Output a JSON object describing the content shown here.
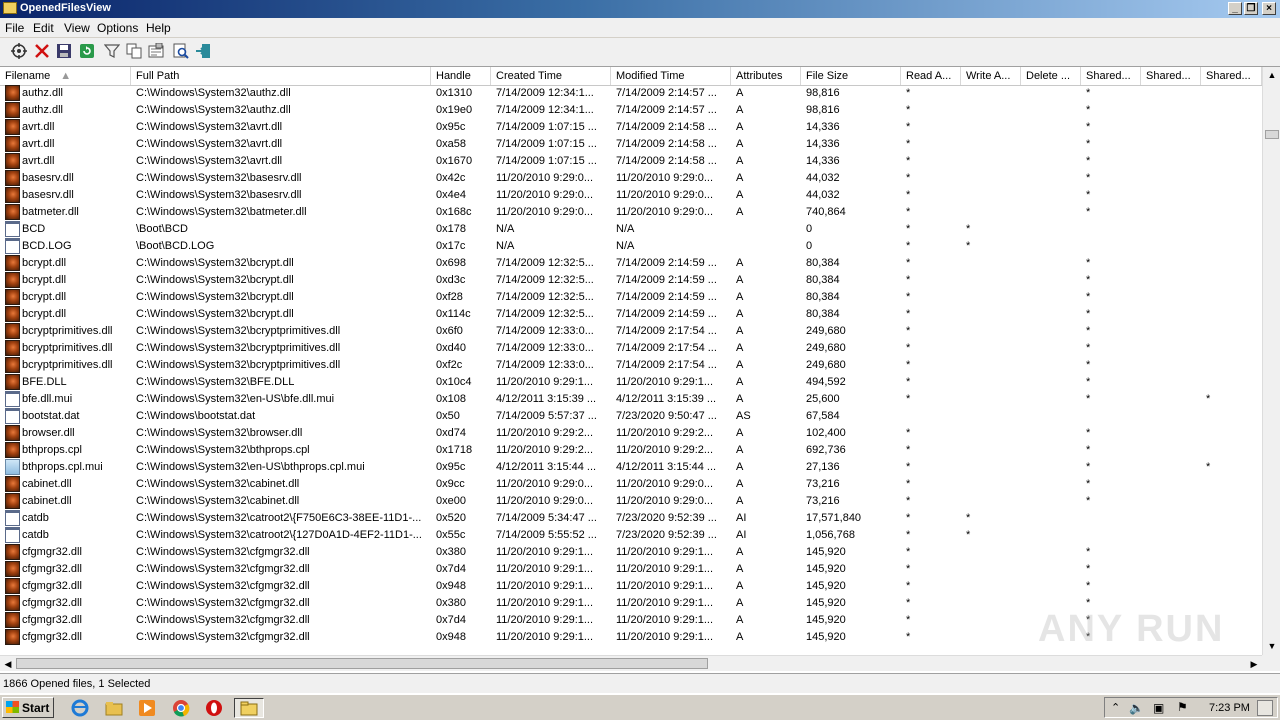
{
  "window": {
    "title": "OpenedFilesView"
  },
  "menu": [
    "File",
    "Edit",
    "View",
    "Options",
    "Help"
  ],
  "toolbar": [
    "properties-icon",
    "close-handle-icon",
    "save-icon",
    "refresh-icon",
    "filter-icon",
    "copy-icon",
    "options-icon",
    "find-icon",
    "exit-icon"
  ],
  "columns": [
    "Filename",
    "Full Path",
    "Handle",
    "Created Time",
    "Modified Time",
    "Attributes",
    "File Size",
    "Read A...",
    "Write A...",
    "Delete ...",
    "Shared...",
    "Shared...",
    "Shared..."
  ],
  "rows": [
    {
      "icon": "dll",
      "name": "authz.dll",
      "path": "C:\\Windows\\System32\\authz.dll",
      "handle": "0x1310",
      "created": "7/14/2009 12:34:1...",
      "modified": "7/14/2009 2:14:57 ...",
      "attr": "A",
      "size": "98,816",
      "read": "*",
      "write": "",
      "del": "",
      "s1": "*",
      "s2": "",
      "s3": ""
    },
    {
      "icon": "dll",
      "name": "authz.dll",
      "path": "C:\\Windows\\System32\\authz.dll",
      "handle": "0x19e0",
      "created": "7/14/2009 12:34:1...",
      "modified": "7/14/2009 2:14:57 ...",
      "attr": "A",
      "size": "98,816",
      "read": "*",
      "write": "",
      "del": "",
      "s1": "*",
      "s2": "",
      "s3": ""
    },
    {
      "icon": "dll",
      "name": "avrt.dll",
      "path": "C:\\Windows\\System32\\avrt.dll",
      "handle": "0x95c",
      "created": "7/14/2009 1:07:15 ...",
      "modified": "7/14/2009 2:14:58 ...",
      "attr": "A",
      "size": "14,336",
      "read": "*",
      "write": "",
      "del": "",
      "s1": "*",
      "s2": "",
      "s3": ""
    },
    {
      "icon": "dll",
      "name": "avrt.dll",
      "path": "C:\\Windows\\System32\\avrt.dll",
      "handle": "0xa58",
      "created": "7/14/2009 1:07:15 ...",
      "modified": "7/14/2009 2:14:58 ...",
      "attr": "A",
      "size": "14,336",
      "read": "*",
      "write": "",
      "del": "",
      "s1": "*",
      "s2": "",
      "s3": ""
    },
    {
      "icon": "dll",
      "name": "avrt.dll",
      "path": "C:\\Windows\\System32\\avrt.dll",
      "handle": "0x1670",
      "created": "7/14/2009 1:07:15 ...",
      "modified": "7/14/2009 2:14:58 ...",
      "attr": "A",
      "size": "14,336",
      "read": "*",
      "write": "",
      "del": "",
      "s1": "*",
      "s2": "",
      "s3": ""
    },
    {
      "icon": "dll",
      "name": "basesrv.dll",
      "path": "C:\\Windows\\System32\\basesrv.dll",
      "handle": "0x42c",
      "created": "11/20/2010 9:29:0...",
      "modified": "11/20/2010 9:29:0...",
      "attr": "A",
      "size": "44,032",
      "read": "*",
      "write": "",
      "del": "",
      "s1": "*",
      "s2": "",
      "s3": ""
    },
    {
      "icon": "dll",
      "name": "basesrv.dll",
      "path": "C:\\Windows\\System32\\basesrv.dll",
      "handle": "0x4e4",
      "created": "11/20/2010 9:29:0...",
      "modified": "11/20/2010 9:29:0...",
      "attr": "A",
      "size": "44,032",
      "read": "*",
      "write": "",
      "del": "",
      "s1": "*",
      "s2": "",
      "s3": ""
    },
    {
      "icon": "dll",
      "name": "batmeter.dll",
      "path": "C:\\Windows\\System32\\batmeter.dll",
      "handle": "0x168c",
      "created": "11/20/2010 9:29:0...",
      "modified": "11/20/2010 9:29:0...",
      "attr": "A",
      "size": "740,864",
      "read": "*",
      "write": "",
      "del": "",
      "s1": "*",
      "s2": "",
      "s3": ""
    },
    {
      "icon": "file",
      "name": "BCD",
      "path": "\\Boot\\BCD",
      "handle": "0x178",
      "created": "N/A",
      "modified": "N/A",
      "attr": "",
      "size": "0",
      "read": "*",
      "write": "*",
      "del": "",
      "s1": "",
      "s2": "",
      "s3": ""
    },
    {
      "icon": "file",
      "name": "BCD.LOG",
      "path": "\\Boot\\BCD.LOG",
      "handle": "0x17c",
      "created": "N/A",
      "modified": "N/A",
      "attr": "",
      "size": "0",
      "read": "*",
      "write": "*",
      "del": "",
      "s1": "",
      "s2": "",
      "s3": ""
    },
    {
      "icon": "dll",
      "name": "bcrypt.dll",
      "path": "C:\\Windows\\System32\\bcrypt.dll",
      "handle": "0x698",
      "created": "7/14/2009 12:32:5...",
      "modified": "7/14/2009 2:14:59 ...",
      "attr": "A",
      "size": "80,384",
      "read": "*",
      "write": "",
      "del": "",
      "s1": "*",
      "s2": "",
      "s3": ""
    },
    {
      "icon": "dll",
      "name": "bcrypt.dll",
      "path": "C:\\Windows\\System32\\bcrypt.dll",
      "handle": "0xd3c",
      "created": "7/14/2009 12:32:5...",
      "modified": "7/14/2009 2:14:59 ...",
      "attr": "A",
      "size": "80,384",
      "read": "*",
      "write": "",
      "del": "",
      "s1": "*",
      "s2": "",
      "s3": ""
    },
    {
      "icon": "dll",
      "name": "bcrypt.dll",
      "path": "C:\\Windows\\System32\\bcrypt.dll",
      "handle": "0xf28",
      "created": "7/14/2009 12:32:5...",
      "modified": "7/14/2009 2:14:59 ...",
      "attr": "A",
      "size": "80,384",
      "read": "*",
      "write": "",
      "del": "",
      "s1": "*",
      "s2": "",
      "s3": ""
    },
    {
      "icon": "dll",
      "name": "bcrypt.dll",
      "path": "C:\\Windows\\System32\\bcrypt.dll",
      "handle": "0x114c",
      "created": "7/14/2009 12:32:5...",
      "modified": "7/14/2009 2:14:59 ...",
      "attr": "A",
      "size": "80,384",
      "read": "*",
      "write": "",
      "del": "",
      "s1": "*",
      "s2": "",
      "s3": ""
    },
    {
      "icon": "dll",
      "name": "bcryptprimitives.dll",
      "path": "C:\\Windows\\System32\\bcryptprimitives.dll",
      "handle": "0x6f0",
      "created": "7/14/2009 12:33:0...",
      "modified": "7/14/2009 2:17:54 ...",
      "attr": "A",
      "size": "249,680",
      "read": "*",
      "write": "",
      "del": "",
      "s1": "*",
      "s2": "",
      "s3": ""
    },
    {
      "icon": "dll",
      "name": "bcryptprimitives.dll",
      "path": "C:\\Windows\\System32\\bcryptprimitives.dll",
      "handle": "0xd40",
      "created": "7/14/2009 12:33:0...",
      "modified": "7/14/2009 2:17:54 ...",
      "attr": "A",
      "size": "249,680",
      "read": "*",
      "write": "",
      "del": "",
      "s1": "*",
      "s2": "",
      "s3": ""
    },
    {
      "icon": "dll",
      "name": "bcryptprimitives.dll",
      "path": "C:\\Windows\\System32\\bcryptprimitives.dll",
      "handle": "0xf2c",
      "created": "7/14/2009 12:33:0...",
      "modified": "7/14/2009 2:17:54 ...",
      "attr": "A",
      "size": "249,680",
      "read": "*",
      "write": "",
      "del": "",
      "s1": "*",
      "s2": "",
      "s3": ""
    },
    {
      "icon": "dll",
      "name": "BFE.DLL",
      "path": "C:\\Windows\\System32\\BFE.DLL",
      "handle": "0x10c4",
      "created": "11/20/2010 9:29:1...",
      "modified": "11/20/2010 9:29:1...",
      "attr": "A",
      "size": "494,592",
      "read": "*",
      "write": "",
      "del": "",
      "s1": "*",
      "s2": "",
      "s3": ""
    },
    {
      "icon": "file",
      "name": "bfe.dll.mui",
      "path": "C:\\Windows\\System32\\en-US\\bfe.dll.mui",
      "handle": "0x108",
      "created": "4/12/2011 3:15:39 ...",
      "modified": "4/12/2011 3:15:39 ...",
      "attr": "A",
      "size": "25,600",
      "read": "*",
      "write": "",
      "del": "",
      "s1": "*",
      "s2": "",
      "s3": "*"
    },
    {
      "icon": "file",
      "name": "bootstat.dat",
      "path": "C:\\Windows\\bootstat.dat",
      "handle": "0x50",
      "created": "7/14/2009 5:57:37 ...",
      "modified": "7/23/2020 9:50:47 ...",
      "attr": "AS",
      "size": "67,584",
      "read": "",
      "write": "",
      "del": "",
      "s1": "",
      "s2": "",
      "s3": ""
    },
    {
      "icon": "dll",
      "name": "browser.dll",
      "path": "C:\\Windows\\System32\\browser.dll",
      "handle": "0xd74",
      "created": "11/20/2010 9:29:2...",
      "modified": "11/20/2010 9:29:2...",
      "attr": "A",
      "size": "102,400",
      "read": "*",
      "write": "",
      "del": "",
      "s1": "*",
      "s2": "",
      "s3": ""
    },
    {
      "icon": "dll",
      "name": "bthprops.cpl",
      "path": "C:\\Windows\\System32\\bthprops.cpl",
      "handle": "0x1718",
      "created": "11/20/2010 9:29:2...",
      "modified": "11/20/2010 9:29:2...",
      "attr": "A",
      "size": "692,736",
      "read": "*",
      "write": "",
      "del": "",
      "s1": "*",
      "s2": "",
      "s3": ""
    },
    {
      "icon": "mui",
      "name": "bthprops.cpl.mui",
      "path": "C:\\Windows\\System32\\en-US\\bthprops.cpl.mui",
      "handle": "0x95c",
      "created": "4/12/2011 3:15:44 ...",
      "modified": "4/12/2011 3:15:44 ...",
      "attr": "A",
      "size": "27,136",
      "read": "*",
      "write": "",
      "del": "",
      "s1": "*",
      "s2": "",
      "s3": "*"
    },
    {
      "icon": "dll",
      "name": "cabinet.dll",
      "path": "C:\\Windows\\System32\\cabinet.dll",
      "handle": "0x9cc",
      "created": "11/20/2010 9:29:0...",
      "modified": "11/20/2010 9:29:0...",
      "attr": "A",
      "size": "73,216",
      "read": "*",
      "write": "",
      "del": "",
      "s1": "*",
      "s2": "",
      "s3": ""
    },
    {
      "icon": "dll",
      "name": "cabinet.dll",
      "path": "C:\\Windows\\System32\\cabinet.dll",
      "handle": "0xe00",
      "created": "11/20/2010 9:29:0...",
      "modified": "11/20/2010 9:29:0...",
      "attr": "A",
      "size": "73,216",
      "read": "*",
      "write": "",
      "del": "",
      "s1": "*",
      "s2": "",
      "s3": ""
    },
    {
      "icon": "file",
      "name": "catdb",
      "path": "C:\\Windows\\System32\\catroot2\\{F750E6C3-38EE-11D1-...",
      "handle": "0x520",
      "created": "7/14/2009 5:34:47 ...",
      "modified": "7/23/2020 9:52:39 ...",
      "attr": "AI",
      "size": "17,571,840",
      "read": "*",
      "write": "*",
      "del": "",
      "s1": "",
      "s2": "",
      "s3": ""
    },
    {
      "icon": "file",
      "name": "catdb",
      "path": "C:\\Windows\\System32\\catroot2\\{127D0A1D-4EF2-11D1-...",
      "handle": "0x55c",
      "created": "7/14/2009 5:55:52 ...",
      "modified": "7/23/2020 9:52:39 ...",
      "attr": "AI",
      "size": "1,056,768",
      "read": "*",
      "write": "*",
      "del": "",
      "s1": "",
      "s2": "",
      "s3": ""
    },
    {
      "icon": "dll",
      "name": "cfgmgr32.dll",
      "path": "C:\\Windows\\System32\\cfgmgr32.dll",
      "handle": "0x380",
      "created": "11/20/2010 9:29:1...",
      "modified": "11/20/2010 9:29:1...",
      "attr": "A",
      "size": "145,920",
      "read": "*",
      "write": "",
      "del": "",
      "s1": "*",
      "s2": "",
      "s3": ""
    },
    {
      "icon": "dll",
      "name": "cfgmgr32.dll",
      "path": "C:\\Windows\\System32\\cfgmgr32.dll",
      "handle": "0x7d4",
      "created": "11/20/2010 9:29:1...",
      "modified": "11/20/2010 9:29:1...",
      "attr": "A",
      "size": "145,920",
      "read": "*",
      "write": "",
      "del": "",
      "s1": "*",
      "s2": "",
      "s3": ""
    },
    {
      "icon": "dll",
      "name": "cfgmgr32.dll",
      "path": "C:\\Windows\\System32\\cfgmgr32.dll",
      "handle": "0x948",
      "created": "11/20/2010 9:29:1...",
      "modified": "11/20/2010 9:29:1...",
      "attr": "A",
      "size": "145,920",
      "read": "*",
      "write": "",
      "del": "",
      "s1": "*",
      "s2": "",
      "s3": ""
    },
    {
      "icon": "dll",
      "name": "cfgmgr32.dll",
      "path": "C:\\Windows\\System32\\cfgmgr32.dll",
      "handle": "0x380",
      "created": "11/20/2010 9:29:1...",
      "modified": "11/20/2010 9:29:1...",
      "attr": "A",
      "size": "145,920",
      "read": "*",
      "write": "",
      "del": "",
      "s1": "*",
      "s2": "",
      "s3": ""
    },
    {
      "icon": "dll",
      "name": "cfgmgr32.dll",
      "path": "C:\\Windows\\System32\\cfgmgr32.dll",
      "handle": "0x7d4",
      "created": "11/20/2010 9:29:1...",
      "modified": "11/20/2010 9:29:1...",
      "attr": "A",
      "size": "145,920",
      "read": "*",
      "write": "",
      "del": "",
      "s1": "*",
      "s2": "",
      "s3": ""
    },
    {
      "icon": "dll",
      "name": "cfgmgr32.dll",
      "path": "C:\\Windows\\System32\\cfgmgr32.dll",
      "handle": "0x948",
      "created": "11/20/2010 9:29:1...",
      "modified": "11/20/2010 9:29:1...",
      "attr": "A",
      "size": "145,920",
      "read": "*",
      "write": "",
      "del": "",
      "s1": "*",
      "s2": "",
      "s3": ""
    }
  ],
  "status": {
    "text": "1866 Opened files, 1 Selected"
  },
  "taskbar": {
    "start_label": "Start",
    "apps": [
      "ie-icon",
      "explorer-icon",
      "media-player-icon",
      "chrome-icon",
      "opera-icon",
      "openedfilesview-icon"
    ],
    "clock": "7:23 PM"
  },
  "watermark": "ANY RUN"
}
